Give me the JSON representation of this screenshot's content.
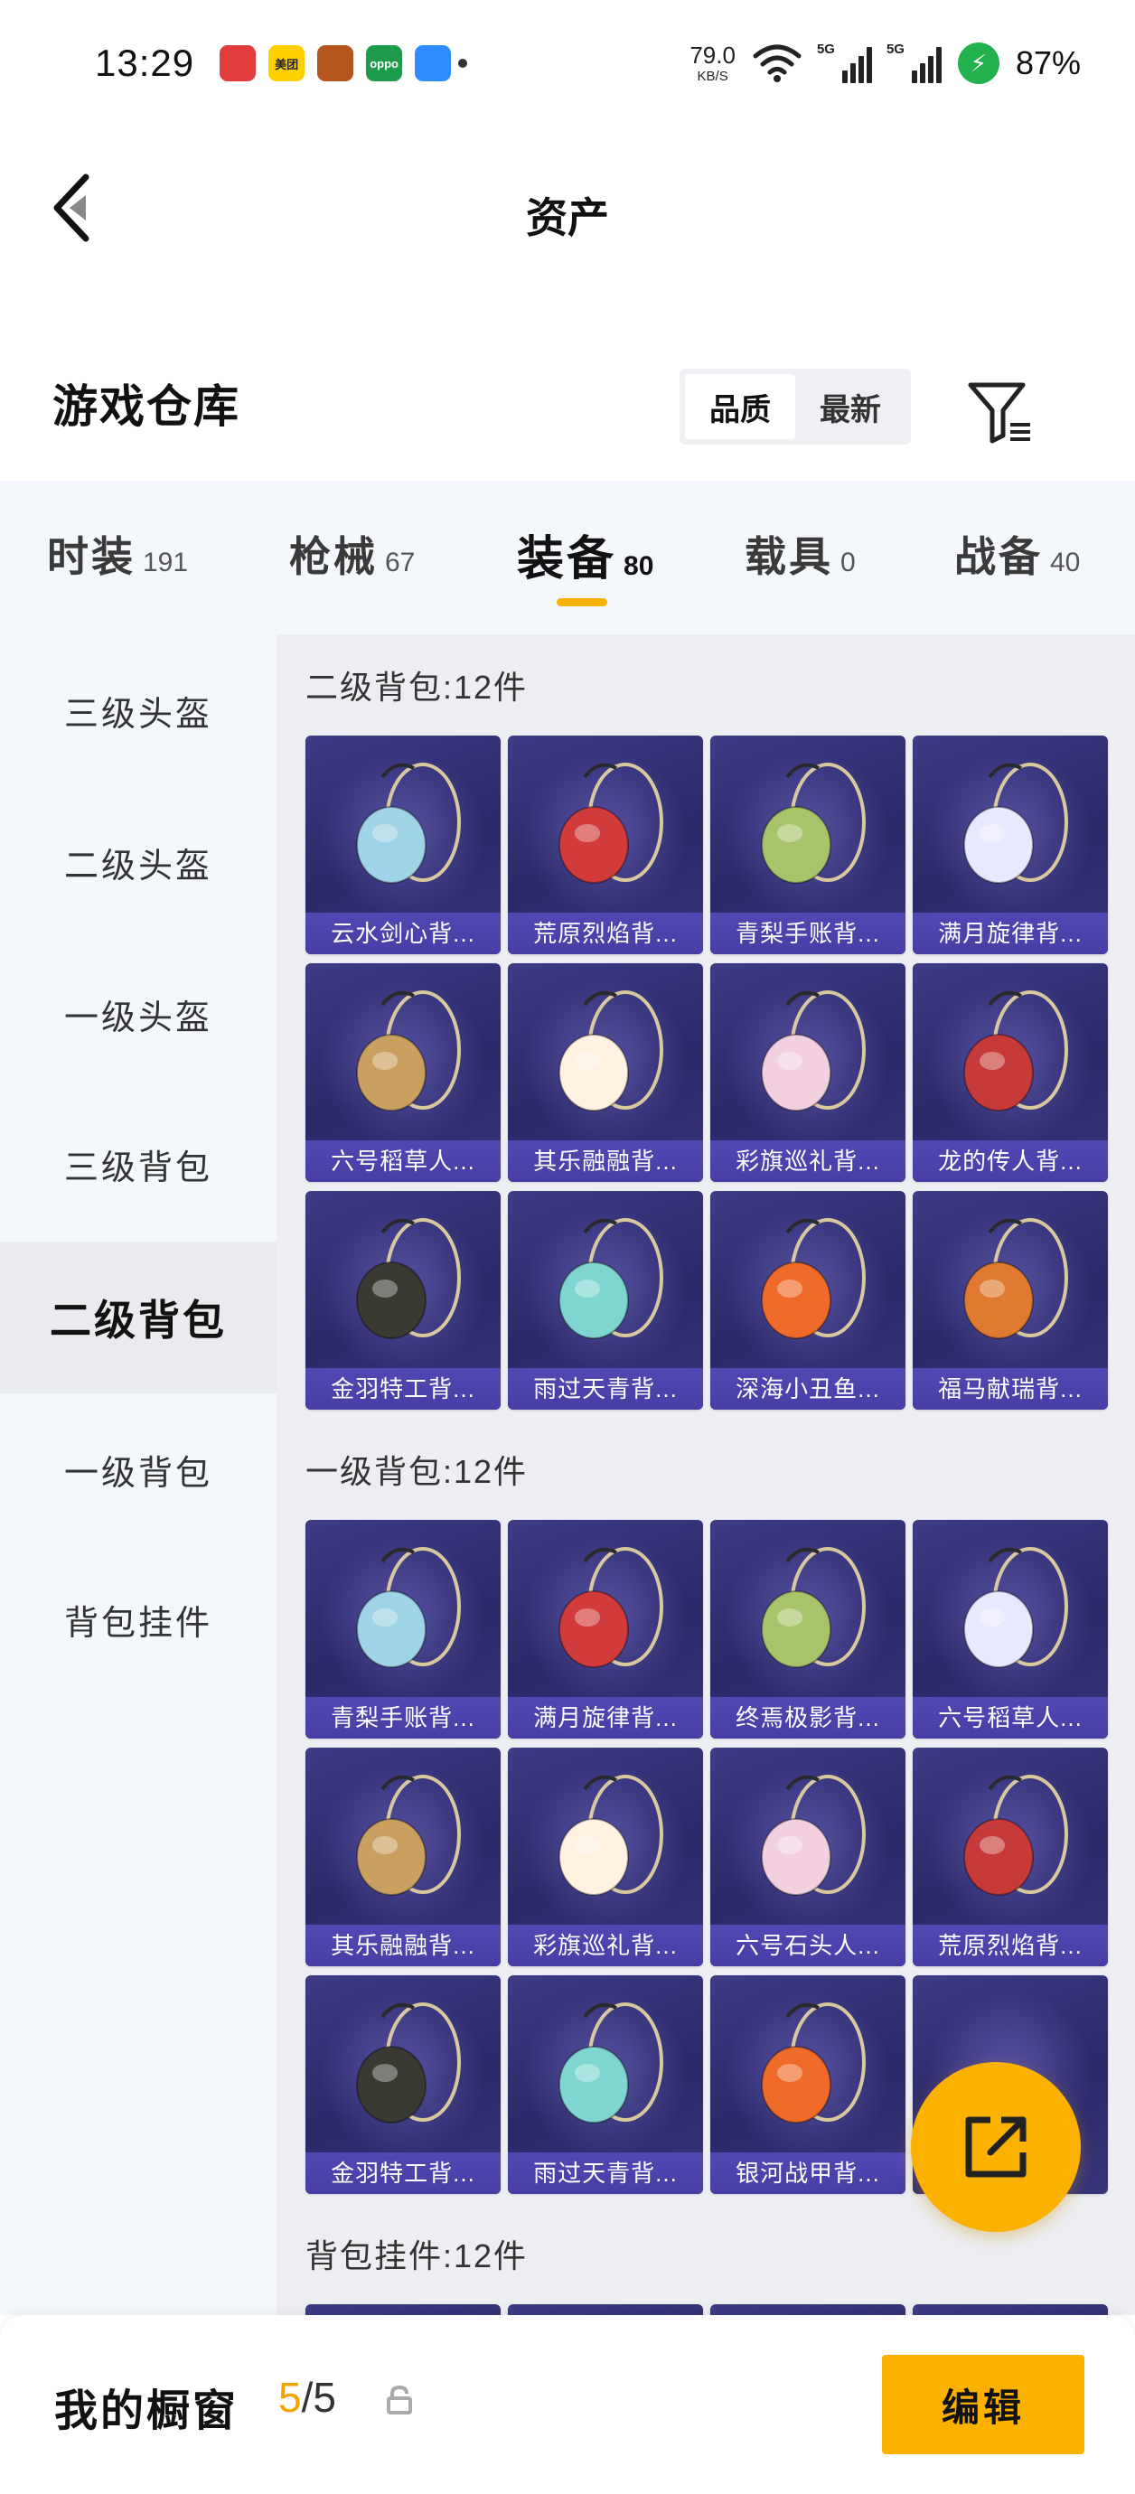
{
  "status_bar": {
    "time": "13:29",
    "apps": [
      {
        "name": "game-app-icon",
        "label": "",
        "color": "#e23c3c"
      },
      {
        "name": "meituan-icon",
        "label": "美团",
        "color": "#ffd000"
      },
      {
        "name": "hero-game-icon",
        "label": "",
        "color": "#b4551e"
      },
      {
        "name": "oppo-icon",
        "label": "oppo",
        "color": "#1e9b4a"
      },
      {
        "name": "cloud-icon",
        "label": "",
        "color": "#2f8cff"
      }
    ],
    "net_speed": "79.0",
    "net_unit": "KB/S",
    "sim1": "5G",
    "sim2": "5G",
    "battery": "87%"
  },
  "header": {
    "title": "资产"
  },
  "section": {
    "title": "游戏仓库",
    "sort_options": [
      "品质",
      "最新"
    ],
    "sort_active": 0
  },
  "tabs": [
    {
      "label": "时装",
      "count": "191"
    },
    {
      "label": "枪械",
      "count": "67"
    },
    {
      "label": "装备",
      "count": "80"
    },
    {
      "label": "载具",
      "count": "0"
    },
    {
      "label": "战备",
      "count": "40"
    }
  ],
  "active_tab": 2,
  "sidebar": {
    "items": [
      "三级头盔",
      "二级头盔",
      "一级头盔",
      "三级背包",
      "二级背包",
      "一级背包",
      "背包挂件"
    ],
    "active": 4
  },
  "groups": [
    {
      "title": "二级背包:12件",
      "items": [
        "云水剑心背...",
        "荒原烈焰背...",
        "青梨手账背...",
        "满月旋律背...",
        "六号稻草人...",
        "其乐融融背...",
        "彩旗巡礼背...",
        "龙的传人背...",
        "金羽特工背...",
        "雨过天青背...",
        "深海小丑鱼...",
        "福马献瑞背..."
      ]
    },
    {
      "title": "一级背包:12件",
      "items": [
        "青梨手账背...",
        "满月旋律背...",
        "终焉极影背...",
        "六号稻草人...",
        "其乐融融背...",
        "彩旗巡礼背...",
        "六号石头人...",
        "荒原烈焰背...",
        "金羽特工背...",
        "雨过天青背...",
        "银河战甲背...",
        ""
      ]
    },
    {
      "title": "背包挂件:12件",
      "items": [
        "",
        "",
        "",
        ""
      ]
    }
  ],
  "bottom": {
    "showcase_label": "我的橱窗",
    "showcase_current": "5",
    "showcase_total": "/5",
    "edit_label": "编辑"
  },
  "colors": {
    "accent": "#fbb100",
    "card_bg": "#2f2d70",
    "card_label_bg": "#4c43ad"
  }
}
